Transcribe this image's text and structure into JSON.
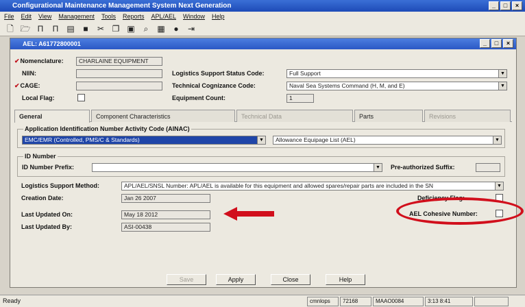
{
  "app": {
    "title": "Configurational Maintenance Management System Next Generation"
  },
  "menu": [
    "File",
    "Edit",
    "View",
    "Management",
    "Tools",
    "Reports",
    "APL/AEL",
    "Window",
    "Help"
  ],
  "child": {
    "title": "AEL: A61772800001"
  },
  "form": {
    "nomenclature_label": "Nomenclature:",
    "nomenclature": "CHARLAINE EQUIPMENT",
    "niin_label": "NIIN:",
    "cage_label": "CAGE:",
    "local_flag_label": "Local Flag:",
    "lss_code_label": "Logistics Support Status Code:",
    "lss_code": "Full Support",
    "tech_cog_label": "Technical Cognizance Code:",
    "tech_cog": "Naval Sea Systems Command (H, M, and E)",
    "equip_count_label": "Equipment Count:",
    "equip_count": "1"
  },
  "tabs": [
    "General",
    "Component Characteristics",
    "Technical Data",
    "Parts",
    "Revisions"
  ],
  "general": {
    "aiac_group": "Application Identification Number Activity Code (AINAC)",
    "aiac_value": "EMC/EMR (Controlled, PMS/C & Standards)",
    "allowance": "Allowance Equipage List (AEL)",
    "id_group": "ID Number",
    "id_prefix_label": "ID Number Prefix:",
    "id_prefix": "",
    "unauth_suffix_label": "Pre-authorized Suffix:",
    "lsm_label": "Logistics Support Method:",
    "lsm": "APL/AEL/SNSL Number: APL/AEL is available for this equipment and allowed spares/repair parts are included in the SN",
    "creation_label": "Creation Date:",
    "creation": "Jan 26 2007",
    "updated_on_label": "Last Updated On:",
    "updated_on": "May 18 2012",
    "updated_by_label": "Last Updated By:",
    "updated_by": "ASI-00438",
    "deficiency_label": "Deficiency Flag:",
    "ael_cohesive_label": "AEL Cohesive Number:"
  },
  "buttons": {
    "save": "Save",
    "apply": "Apply",
    "close": "Close",
    "help": "Help"
  },
  "status": {
    "ready": "Ready",
    "s1": "cmnlops",
    "s2": "72168",
    "s3": "MAAO0084",
    "s4": "3:13 8:41"
  },
  "colors": {
    "arrow": "#d10f1c",
    "oval": "#d10f1c",
    "titlebar": "#1e4bb7"
  }
}
